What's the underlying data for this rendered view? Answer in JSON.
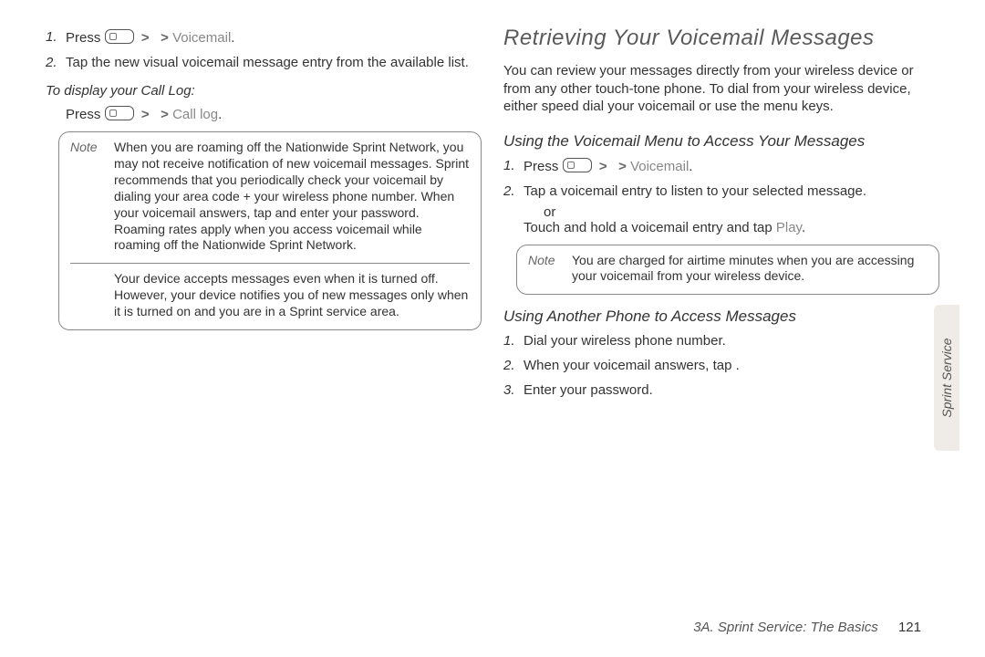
{
  "left": {
    "step1_press": "Press",
    "step1_tail": "Voicemail",
    "step2": "Tap the new visual voicemail message entry from the available list.",
    "sub_calllog": "To display your Call Log:",
    "calllog_press": "Press",
    "calllog_tail": "Call log",
    "note1_label": "Note",
    "note1_p1a": "When you are roaming off the Nationwide Sprint Network, you may not receive notification of new voicemail messages. Sprint",
    "note1_p1b": "recommends that you periodically check your voicemail by dialing your area code + your wireless phone number. When your voicemail answers, tap ",
    "note1_p1c": " and enter your password. Roaming rates apply when you access voicemail while roaming off the Nationwide Sprint Network.",
    "note1_p2": "Your device accepts messages even when it is turned off. However, your device notifies you of new messages only when it is turned on and you are in a Sprint service area."
  },
  "right": {
    "title": "Retrieving Your Voicemail Messages",
    "intro": "You can review your messages directly from your wireless device or from any other touch-tone phone. To dial from your wireless device, either speed dial your voicemail or use the menu keys.",
    "sub_menu": "Using the Voicemail Menu to Access Your Messages",
    "step1_press": "Press",
    "step1_tail": "Voicemail",
    "step2": "Tap a voicemail entry to listen to your selected message.",
    "step2_or": "or",
    "step2_alt_a": "Touch and hold a voicemail entry and tap",
    "step2_alt_b": "Play",
    "note_label": "Note",
    "note_body": "You are charged for airtime minutes when you are accessing your voicemail from your wireless device.",
    "sub_other": "Using Another Phone to Access Messages",
    "other1": "Dial your wireless phone number.",
    "other2": "When your voicemail answers, tap ",
    "other3": "Enter your password."
  },
  "sidetab": "Sprint Service",
  "footer_section": "3A. Sprint Service: The Basics",
  "footer_page": "121"
}
